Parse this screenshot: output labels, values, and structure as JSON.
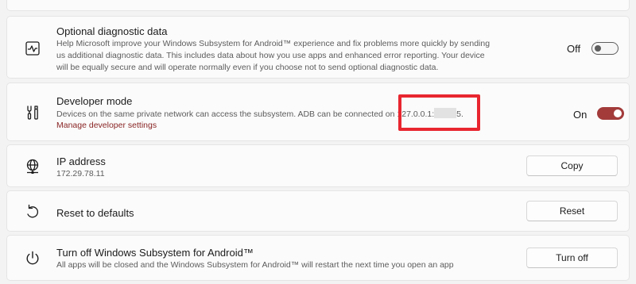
{
  "top_partial_text": "",
  "diagnostic": {
    "title": "Optional diagnostic data",
    "desc_lines": [
      "Help Microsoft improve your Windows Subsystem for Android™ experience and fix problems more quickly by sending",
      "us additional diagnostic data. This includes data about how you use apps and enhanced error reporting. Your device",
      "will be equally secure and will operate normally even if you choose not to send optional diagnostic data."
    ],
    "state_label": "Off",
    "toggle_on": false,
    "icon": "pulse-icon"
  },
  "developer": {
    "title": "Developer mode",
    "desc_before": "Devices on the same private network can access the subsystem. ADB can be connected on ",
    "address_prefix": "127.0.0.1:",
    "address_suffix": "5.",
    "link": "Manage developer settings",
    "state_label": "On",
    "toggle_on": true,
    "icon": "tools-icon"
  },
  "ip": {
    "title": "IP address",
    "value": "172.29.78.11",
    "button": "Copy",
    "icon": "globe-network-icon"
  },
  "reset": {
    "title": "Reset to defaults",
    "button": "Reset",
    "icon": "reset-arrow-icon"
  },
  "turnoff": {
    "title": "Turn off Windows Subsystem for Android™",
    "desc": "All apps will be closed and the Windows Subsystem for Android™ will restart the next time you open an app",
    "button": "Turn off",
    "icon": "power-icon"
  },
  "colors": {
    "accent": "#a33b3b",
    "link": "#8a2424",
    "annotation": "#e8262f"
  }
}
